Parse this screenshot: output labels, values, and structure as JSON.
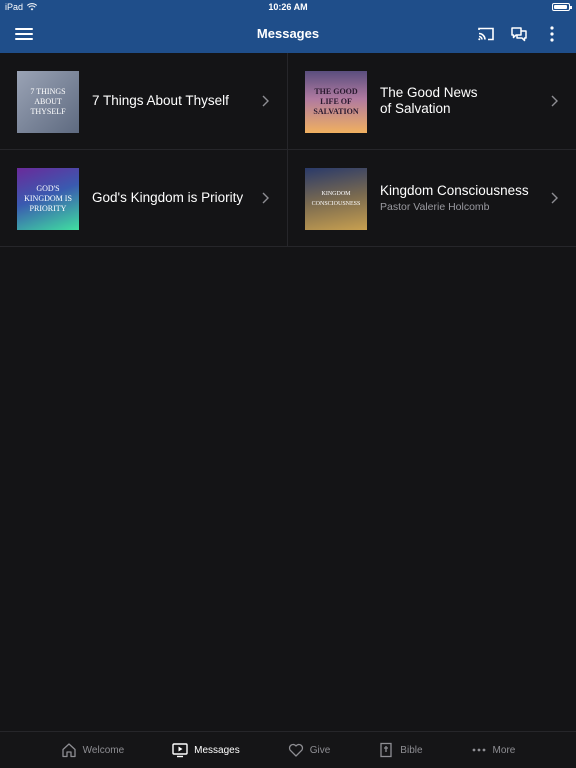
{
  "status_bar": {
    "device": "iPad",
    "time": "10:26 AM"
  },
  "nav": {
    "title": "Messages"
  },
  "messages": [
    {
      "title": "7 Things About Thyself",
      "subtitle": "",
      "thumb_text": "7 THINGS ABOUT THYSELF",
      "thumb_colors": [
        "#8a95a8",
        "#6f7a90"
      ]
    },
    {
      "title": "The Good News\nof Salvation",
      "subtitle": "",
      "thumb_text": "THE GOOD LIFE OF SALVATION",
      "thumb_colors": [
        "#6a5a86",
        "#e0a060"
      ]
    },
    {
      "title": "God's Kingdom is Priority",
      "subtitle": "",
      "thumb_text": "GOD'S KINGDOM IS PRIORITY",
      "thumb_colors": [
        "#5a2a8a",
        "#3fd8a8"
      ]
    },
    {
      "title": "Kingdom Consciousness",
      "subtitle": "Pastor Valerie Holcomb",
      "thumb_text": "KINGDOM CONSCIOUSNESS",
      "thumb_colors": [
        "#2c3f6a",
        "#c8a050"
      ]
    }
  ],
  "tabs": [
    {
      "label": "Welcome",
      "icon": "home-icon",
      "active": false
    },
    {
      "label": "Messages",
      "icon": "tv-play-icon",
      "active": true
    },
    {
      "label": "Give",
      "icon": "heart-icon",
      "active": false
    },
    {
      "label": "Bible",
      "icon": "bible-icon",
      "active": false
    },
    {
      "label": "More",
      "icon": "more-dots-icon",
      "active": false
    }
  ],
  "colors": {
    "accent": "#1f4e8a",
    "background": "#141416"
  }
}
